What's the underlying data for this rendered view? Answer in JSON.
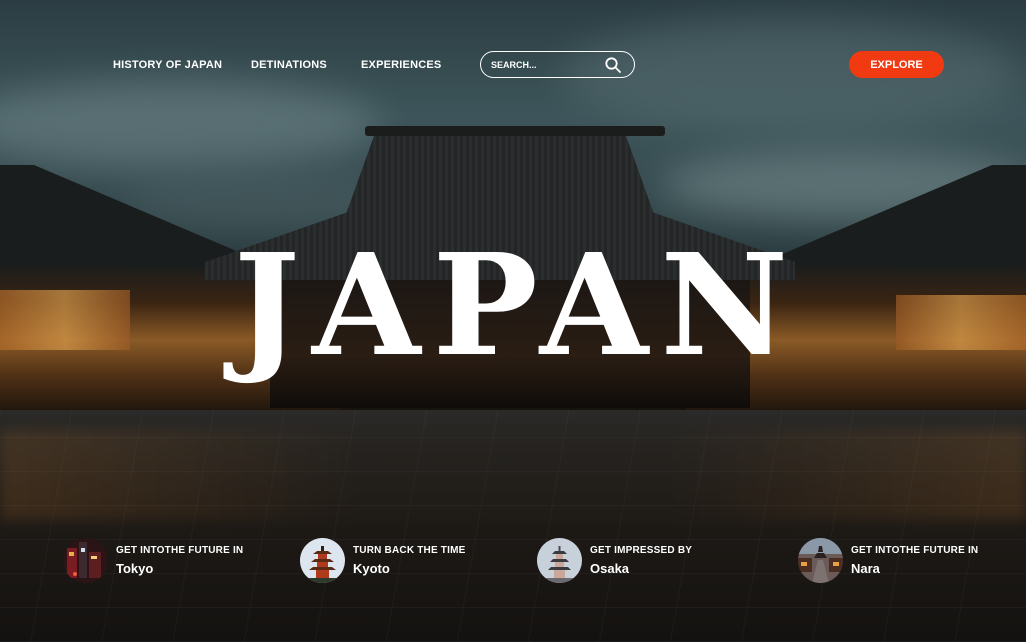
{
  "nav": {
    "links": [
      "HISTORY OF JAPAN",
      "DETINATIONS",
      "EXPERIENCES"
    ],
    "search_placeholder": "SEARCH...",
    "explore_label": "EXPLORE"
  },
  "hero": {
    "title": "JAPAN"
  },
  "destinations": [
    {
      "tagline": "GET INTOTHE FUTURE IN",
      "city": "Tokyo"
    },
    {
      "tagline": "TURN BACK THE TIME",
      "city": "Kyoto"
    },
    {
      "tagline": "GET IMPRESSED BY",
      "city": "Osaka"
    },
    {
      "tagline": "GET INTOTHE FUTURE IN",
      "city": "Nara"
    }
  ],
  "colors": {
    "accent": "#f23a12",
    "text": "#ffffff"
  },
  "icons": {
    "search": "search-icon"
  }
}
